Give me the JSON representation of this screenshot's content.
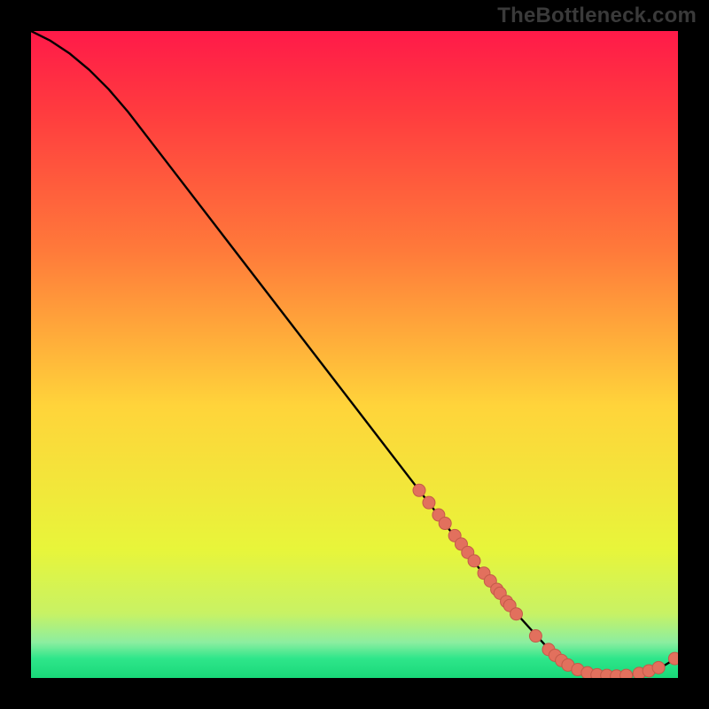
{
  "watermark": "TheBottleneck.com",
  "colors": {
    "page_bg": "#000000",
    "gradient_top": "#ff1a49",
    "gradient_mid1": "#ff7a3a",
    "gradient_mid2": "#ffd43a",
    "gradient_mid3": "#e8f53a",
    "gradient_bottom": "#2ee68a",
    "curve": "#000000",
    "points_fill": "#e2705d",
    "points_stroke": "#c45a49"
  },
  "chart_data": {
    "type": "line",
    "title": "",
    "xlabel": "",
    "ylabel": "",
    "xlim": [
      0,
      100
    ],
    "ylim": [
      0,
      100
    ],
    "grid": false,
    "legend": false,
    "series": [
      {
        "name": "curve",
        "kind": "line",
        "x": [
          0,
          3,
          6,
          9,
          12,
          15,
          20,
          30,
          40,
          50,
          60,
          70,
          75,
          80,
          83,
          85,
          88,
          90,
          92,
          94,
          96,
          98,
          100
        ],
        "y": [
          100,
          98.5,
          96.5,
          94,
          91,
          87.5,
          81,
          68,
          55,
          42,
          29,
          16,
          10,
          4.5,
          2.0,
          1.0,
          0.4,
          0.3,
          0.4,
          0.7,
          1.2,
          2.0,
          3.2
        ]
      },
      {
        "name": "points",
        "kind": "scatter",
        "x": [
          60,
          61.5,
          63,
          64,
          65.5,
          66.5,
          67.5,
          68.5,
          70,
          71,
          72,
          72.5,
          73.5,
          74,
          75,
          78,
          80,
          81,
          82,
          83,
          84.5,
          86,
          87.5,
          89,
          90.5,
          92,
          94,
          95.5,
          97,
          99.5
        ],
        "y": [
          29.0,
          27.1,
          25.2,
          23.9,
          22.0,
          20.7,
          19.4,
          18.1,
          16.2,
          15.0,
          13.7,
          13.1,
          11.8,
          11.2,
          9.9,
          6.5,
          4.4,
          3.5,
          2.7,
          2.0,
          1.3,
          0.8,
          0.5,
          0.4,
          0.3,
          0.4,
          0.7,
          1.1,
          1.6,
          3.0
        ]
      }
    ]
  }
}
